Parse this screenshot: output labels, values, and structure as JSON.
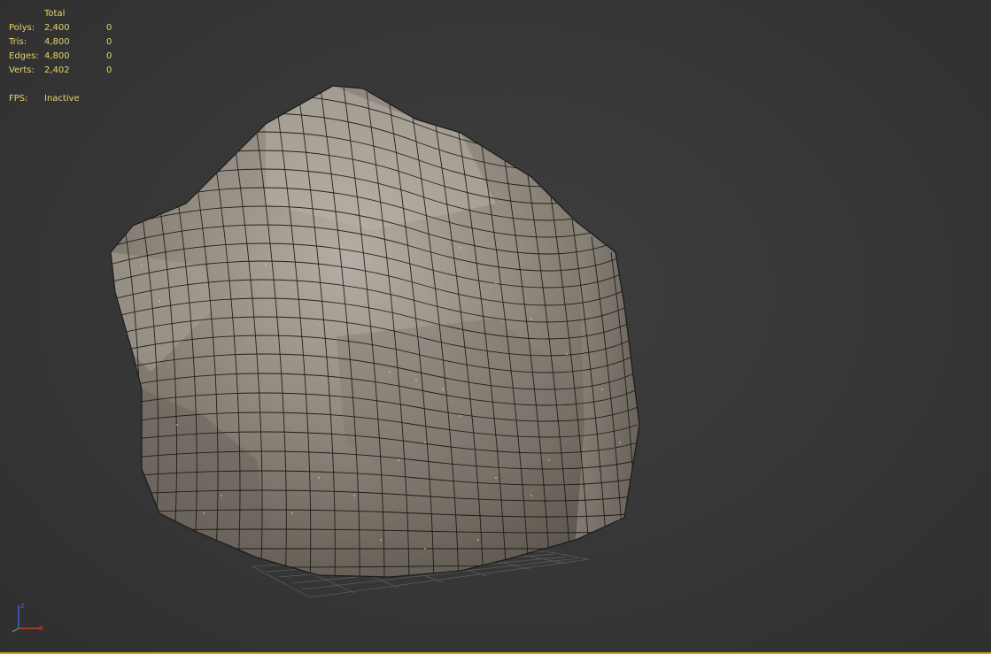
{
  "stats": {
    "header": "Total",
    "rows": [
      {
        "label": "Polys:",
        "total": "2,400",
        "selected": "0"
      },
      {
        "label": "Tris:",
        "total": "4,800",
        "selected": "0"
      },
      {
        "label": "Edges:",
        "total": "4,800",
        "selected": "0"
      },
      {
        "label": "Verts:",
        "total": "2,402",
        "selected": "0"
      }
    ],
    "fps_label": "FPS:",
    "fps_value": "Inactive"
  },
  "gizmo": {
    "z_label": "z",
    "x_label": "x",
    "z_color": "#3a5fd0",
    "x_color": "#c83a2a"
  },
  "colors": {
    "stats_text": "#e6d36a",
    "viewport_bg": "#383838",
    "rock_base": "#8a8278",
    "wire": "#111111",
    "grid": "#5a5a5a",
    "active_border": "#c89b2a"
  }
}
